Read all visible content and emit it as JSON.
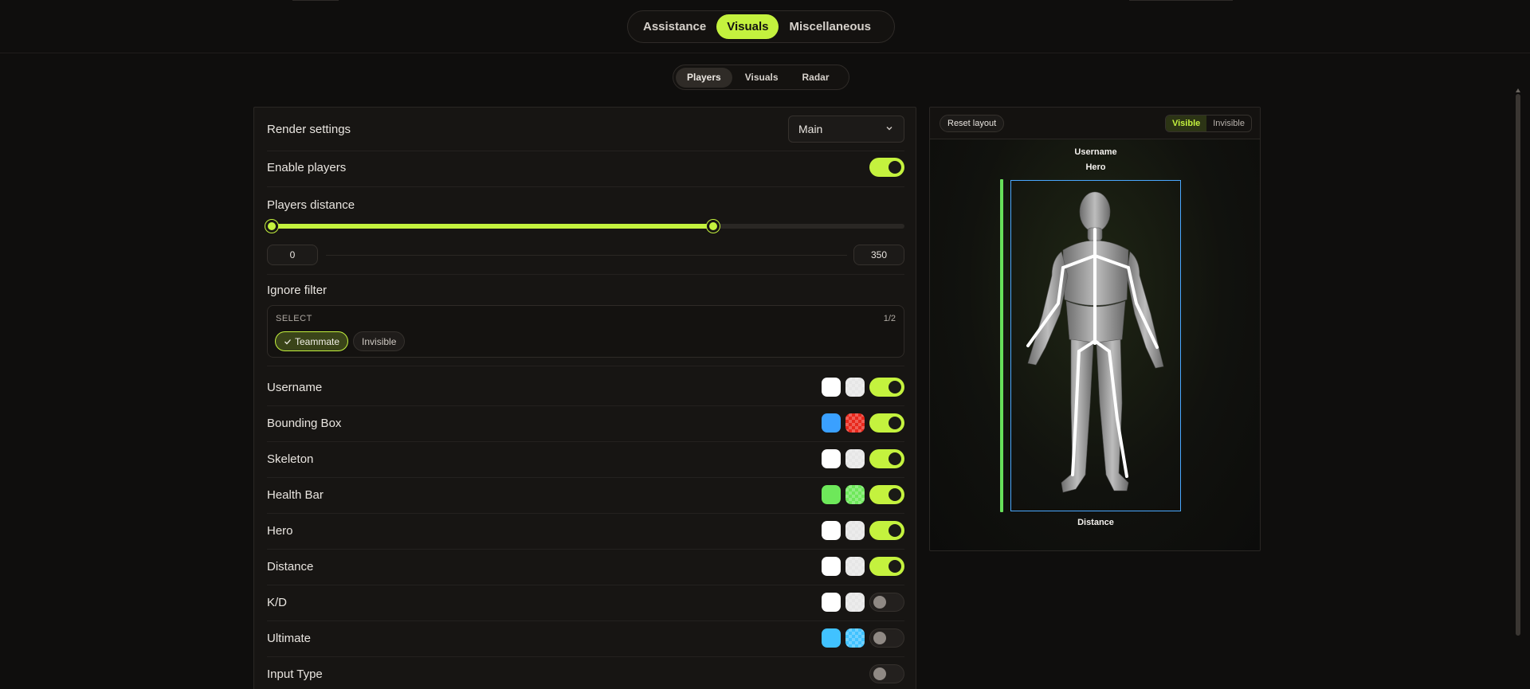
{
  "main_tabs": [
    "Assistance",
    "Visuals",
    "Miscellaneous"
  ],
  "main_tab_active": "Visuals",
  "sub_tabs": [
    "Players",
    "Visuals",
    "Radar"
  ],
  "sub_tab_active": "Players",
  "panel": {
    "render_settings": {
      "label": "Render settings",
      "value": "Main"
    },
    "enable_players": {
      "label": "Enable players",
      "enabled": true
    },
    "players_distance": {
      "label": "Players distance",
      "min_value": "0",
      "max_value": "350",
      "fill_fraction": 0.7
    },
    "ignore_filter": {
      "label": "Ignore filter",
      "select_label": "SELECT",
      "count": "1/2",
      "options": [
        {
          "label": "Teammate",
          "selected": true
        },
        {
          "label": "Invisible",
          "selected": false
        }
      ]
    },
    "features": [
      {
        "label": "Username",
        "color1": "#ffffff",
        "color2": "#e6e6e6",
        "enabled": true
      },
      {
        "label": "Bounding Box",
        "color1": "#3aa0ff",
        "color2": "#e8281c",
        "enabled": true
      },
      {
        "label": "Skeleton",
        "color1": "#ffffff",
        "color2": "#e6e6e6",
        "enabled": true
      },
      {
        "label": "Health Bar",
        "color1": "#6ee85a",
        "color2": "#6ee85a",
        "enabled": true
      },
      {
        "label": "Hero",
        "color1": "#ffffff",
        "color2": "#e6e6e6",
        "enabled": true
      },
      {
        "label": "Distance",
        "color1": "#ffffff",
        "color2": "#e6e6e6",
        "enabled": true
      },
      {
        "label": "K/D",
        "color1": "#ffffff",
        "color2": "#e6e6e6",
        "enabled": false
      },
      {
        "label": "Ultimate",
        "color1": "#41c2ff",
        "color2": "#41c2ff",
        "enabled": false
      },
      {
        "label": "Input Type",
        "enabled": false
      }
    ]
  },
  "preview": {
    "reset_label": "Reset layout",
    "visible_label": "Visible",
    "invisible_label": "Invisible",
    "username_label": "Username",
    "hero_label": "Hero",
    "distance_label": "Distance"
  },
  "colors": {
    "accent": "#c4f23e",
    "bg": "#0f0e0d",
    "panel": "#171513"
  }
}
